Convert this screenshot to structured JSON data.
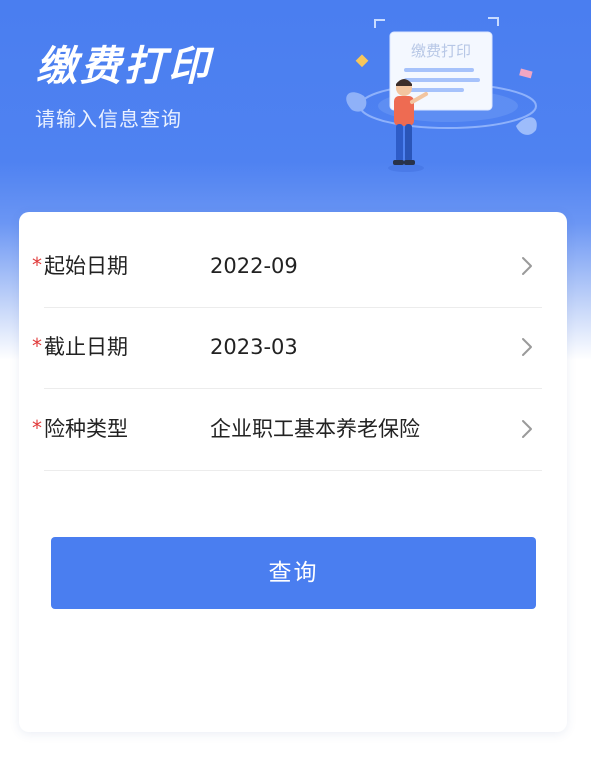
{
  "header": {
    "title": "缴费打印",
    "subtitle": "请输入信息查询",
    "illustration_sign": "缴费打印"
  },
  "form": {
    "rows": [
      {
        "label": "起始日期",
        "value": "2022-09",
        "required": true
      },
      {
        "label": "截止日期",
        "value": "2023-03",
        "required": true
      },
      {
        "label": "险种类型",
        "value": "企业职工基本养老保险",
        "required": true
      }
    ],
    "required_mark": "*",
    "submit_label": "查询"
  },
  "colors": {
    "primary": "#4a7ef0",
    "required": "#e03a3a",
    "text": "#222222",
    "divider": "#ececec"
  },
  "icons": {
    "row_arrow": "chevron-right-icon"
  }
}
